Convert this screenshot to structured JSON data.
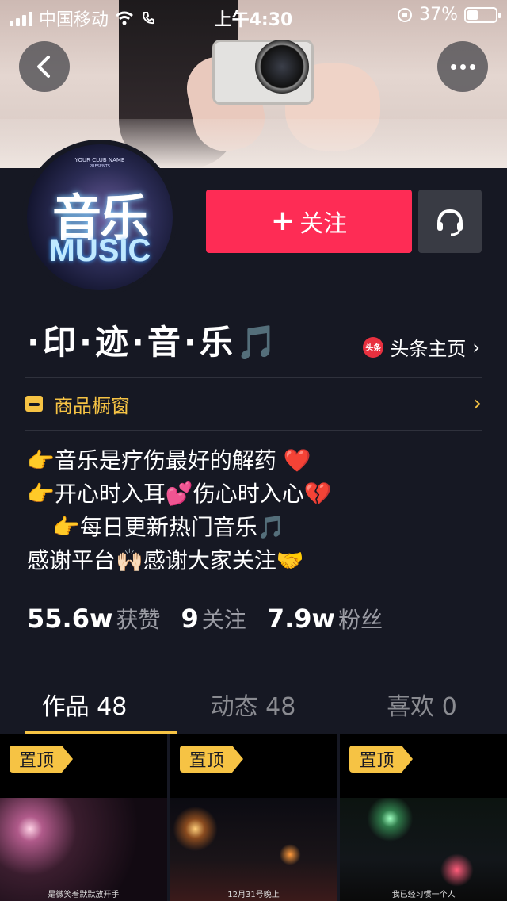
{
  "status_bar": {
    "carrier": "中国移动",
    "time": "上午4:30",
    "battery": "37%",
    "battery_level": 0.37
  },
  "avatar": {
    "club_name": "YOUR CLUB NAME",
    "presents": "PRESENTS",
    "title_cn": "音乐",
    "title_en": "MUSIC"
  },
  "actions": {
    "follow_label": "关注"
  },
  "profile": {
    "nickname": "·印·迹·音·乐🎵",
    "toutiao_badge": "头条",
    "toutiao_label": "头条主页"
  },
  "shop": {
    "label": "商品橱窗"
  },
  "bio": [
    "👉音乐是疗伤最好的解药 ❤️",
    "👉开心时入耳💕伤心时入心💔",
    "👉每日更新热门音乐🎵",
    "感谢平台🙌🏻感谢大家关注🤝"
  ],
  "stats": [
    {
      "value": "55.6w",
      "label": "获赞"
    },
    {
      "value": "9",
      "label": "关注"
    },
    {
      "value": "7.9w",
      "label": "粉丝"
    }
  ],
  "tabs": [
    {
      "label": "作品 48"
    },
    {
      "label": "动态 48"
    },
    {
      "label": "喜欢 0"
    }
  ],
  "videos": [
    {
      "badge": "置顶",
      "caption": "是微笑着默默放开手"
    },
    {
      "badge": "置顶",
      "caption": "12月31号晚上"
    },
    {
      "badge": "置顶",
      "caption": "我已经习惯一个人"
    }
  ],
  "colors": {
    "background": "#161823",
    "accent_red": "#fe2c55",
    "accent_yellow": "#f6c344"
  }
}
